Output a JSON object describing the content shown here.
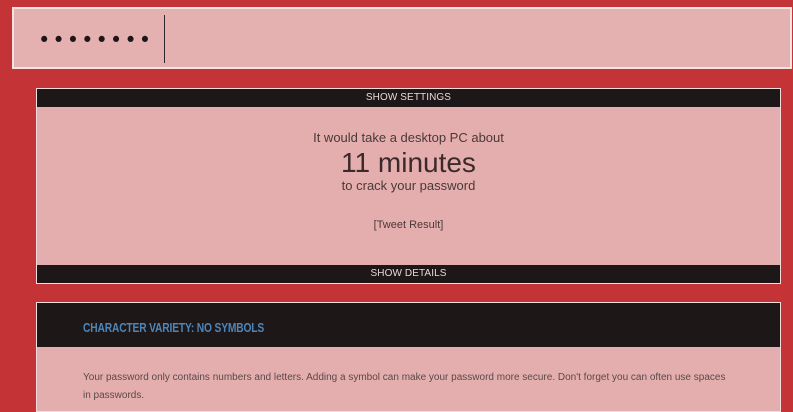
{
  "password_field": {
    "masked_value": "••••••••"
  },
  "top_panel": {
    "settings_toggle": "SHOW SETTINGS",
    "line1": "It would take a desktop PC about",
    "time": "11 minutes",
    "line3": "to crack your password",
    "tweet": "[Tweet Result]",
    "details_toggle": "SHOW DETAILS"
  },
  "notice": {
    "title": "CHARACTER VARIETY: NO SYMBOLS",
    "body": "Your password only contains numbers and letters. Adding a symbol can make your password more secure. Don't forget you can often use spaces in passwords."
  },
  "colors": {
    "page_bg": "#c43336",
    "panel_bg": "#e5aeae",
    "bar_bg": "#1d1718",
    "title_blue": "#4d86b8"
  }
}
